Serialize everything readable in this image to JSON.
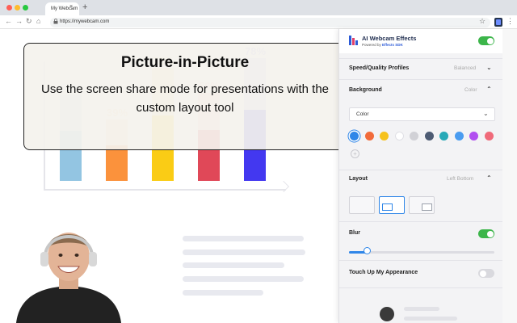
{
  "browser": {
    "tab_title": "My Webcam",
    "tab_close": "×",
    "new_tab": "+",
    "url": "https://mywebcam.com",
    "nav_back": "←",
    "nav_forward": "→",
    "nav_reload": "↻",
    "nav_home": "⌂",
    "lock_icon": "🔒",
    "star_icon": "☆",
    "menu_icon": "⋮",
    "colors": {
      "close": "#ff5f57",
      "minimize": "#febc2e",
      "maximize": "#28c840"
    }
  },
  "background_chart": {
    "bars": [
      {
        "pct": "55%",
        "value": 55,
        "color": "#93c5e2",
        "light": "#cfe4f1"
      },
      {
        "pct": "39%",
        "value": 39,
        "color": "#fb923c",
        "light": "#fde2c9"
      },
      {
        "pct": "72%",
        "value": 72,
        "color": "#facc15",
        "light": "#fdf0b8"
      },
      {
        "pct": "56%",
        "value": 56,
        "color": "#e04858",
        "light": "#f6cfd3"
      },
      {
        "pct": "78%",
        "value": 78,
        "color": "#4338f0",
        "light": "#cfd0f6"
      }
    ]
  },
  "overlay": {
    "title": "Picture-in-Picture",
    "body": "Use the screen share mode for presentations with the custom layout tool"
  },
  "panel": {
    "brand": "AI Webcam Effects",
    "brand_sub_prefix": "Powered by ",
    "brand_sub_link": "Effects SDK",
    "master_toggle": true,
    "speed_quality": {
      "label": "Speed/Quality Profiles",
      "value": "Balanced"
    },
    "background": {
      "label": "Background",
      "value": "Color",
      "select_value": "Color",
      "swatches": [
        "#2f86e8",
        "#f26b3a",
        "#f6c21c",
        "#ffffff",
        "#d1d1d6",
        "#4d5b73",
        "#27a9b7",
        "#4a9cf0",
        "#b14ef0",
        "#f06a7a"
      ],
      "selected_index": 0,
      "add_label": "+"
    },
    "layout": {
      "label": "Layout",
      "value": "Left Bottom",
      "selected_index": 1
    },
    "blur": {
      "label": "Blur",
      "enabled": true,
      "level": 0.12
    },
    "touch_up": {
      "label": "Touch Up My Appearance",
      "enabled": false
    },
    "accent": "#2f86e8",
    "toggle_on": "#3cb54a",
    "toggle_off": "#d9d9de"
  }
}
